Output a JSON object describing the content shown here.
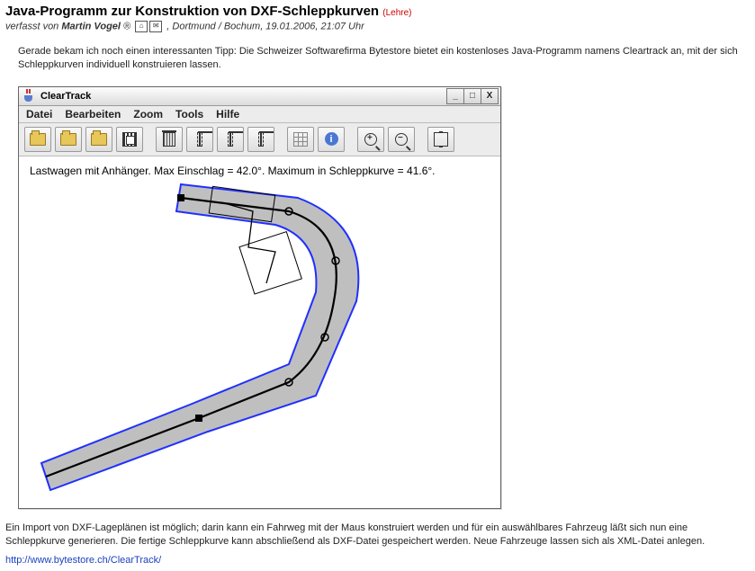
{
  "post": {
    "title": "Java-Programm zur Konstruktion von DXF-Schleppkurven",
    "tag": "(Lehre)",
    "byline_prefix": "verfasst von ",
    "author": "Martin Vogel",
    "author_badge": "®",
    "location_date": ", Dortmund / Bochum, 19.01.2006, 21:07 Uhr",
    "body1": "Gerade bekam ich noch einen interessanten Tipp: Die Schweizer Softwarefirma Bytestore bietet ein kostenloses Java-Programm namens Cleartrack an, mit der sich Schleppkurven individuell konstruieren lassen.",
    "body2": "Ein Import von DXF-Lageplänen ist möglich; darin kann ein Fahrweg mit der Maus konstruiert werden und für ein auswählbares Fahrzeug läßt sich nun eine Schleppkurve generieren. Die fertige Schleppkurve kann abschließend als DXF-Datei gespeichert werden. Neue Fahrzeuge lassen sich als XML-Datei anlegen.",
    "link": "http://www.bytestore.ch/ClearTrack/"
  },
  "app": {
    "title": "ClearTrack",
    "menus": {
      "file": "Datei",
      "edit": "Bearbeiten",
      "zoom": "Zoom",
      "tools": "Tools",
      "help": "Hilfe"
    },
    "status": "Lastwagen mit Anhänger. Max Einschlag = 42.0°. Maximum in Schleppkurve = 41.6°."
  }
}
